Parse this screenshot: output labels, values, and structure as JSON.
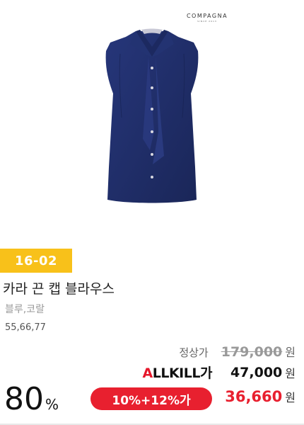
{
  "brand": {
    "name": "COMPAGNA",
    "sub": "SINCE 2013"
  },
  "product": {
    "code": "16-02",
    "title": "카라 끈 캡 블라우스",
    "colors": "블루,코랄",
    "sizes": "55,66,77",
    "image_icon": "blouse-image"
  },
  "pricing": {
    "regular_label": "정상가",
    "regular_price": "179,000",
    "won": "원",
    "allkill_logo_a": "A",
    "allkill_logo_rest": "LLKILL가",
    "allkill_price": "47,000",
    "coupon_label": "10%+12%가",
    "final_price": "36,660",
    "discount_rate": "80",
    "discount_unit": "%"
  },
  "colors": {
    "badge_yellow": "#f8c11a",
    "accent_red": "#e8202f",
    "blouse_navy": "#1f2e66"
  }
}
